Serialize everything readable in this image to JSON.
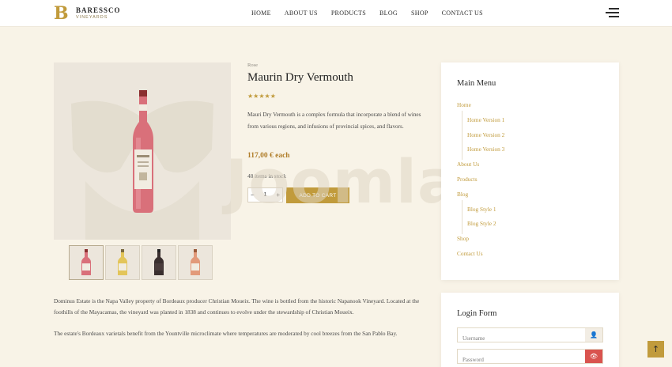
{
  "brand": {
    "name": "BARESSCO",
    "sub": "VINEYARDS",
    "mark": "B"
  },
  "nav": [
    "HOME",
    "ABOUT US",
    "PRODUCTS",
    "BLOG",
    "SHOP",
    "CONTACT US"
  ],
  "product": {
    "category": "Rose",
    "title": "Maurin Dry Vermouth",
    "rating_stars": 5,
    "stars_text": "★★★★★",
    "description": "Mauri Dry Vermouth is a complex formula that incorporate a blend of wines from various regions, and infusions of provincial spices, and flavors.",
    "price": "117,00 € each",
    "stock": "48 items in stock",
    "qty_minus": "−",
    "qty_value": "1",
    "qty_plus": "+",
    "add_to_cart": "ADD TO CART",
    "long_description": [
      "Dominus Estate is the Napa Valley property of Bordeaux producer Christian Moueix. The wine is bottled from the historic Napanook Vineyard. Located at the foothills of the Mayacamas, the vineyard was planted in 1838 and continues to evolve under the stewardship of Christian Moueix.",
      "The estate's Bordeaux varietals benefit from the Yountville microclimate where temperatures are moderated by cool breezes from the San Pablo Bay."
    ]
  },
  "watermark": "Joomla.bid",
  "sidebar": {
    "menu_title": "Main Menu",
    "menu": [
      {
        "label": "Home",
        "sub": false
      },
      {
        "label": "Home Version 1",
        "sub": true
      },
      {
        "label": "Home Version 2",
        "sub": true
      },
      {
        "label": "Home Version 3",
        "sub": true
      },
      {
        "label": "About Us",
        "sub": false
      },
      {
        "label": "Products",
        "sub": false
      },
      {
        "label": "Blog",
        "sub": false
      },
      {
        "label": "Blog Style 1",
        "sub": true
      },
      {
        "label": "Blog Style 2",
        "sub": true
      },
      {
        "label": "Shop",
        "sub": false
      },
      {
        "label": "Contact Us",
        "sub": false
      }
    ],
    "login_title": "Login Form",
    "username_placeholder": "Username",
    "password_placeholder": "Password"
  },
  "colors": {
    "accent": "#c19b3c",
    "background": "#f8f3e7",
    "danger": "#d9534f"
  },
  "icons": {
    "user": "user-icon",
    "eye": "eye-icon",
    "to_top": "arrow-up-icon",
    "menu": "hamburger-icon"
  }
}
